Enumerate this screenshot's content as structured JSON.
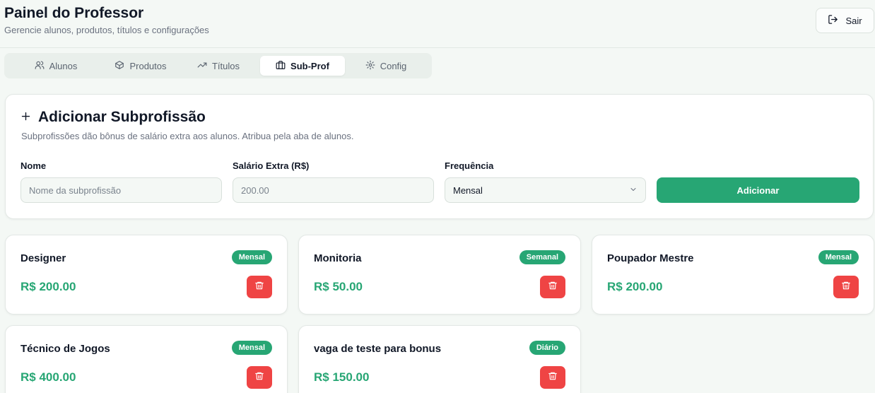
{
  "header": {
    "title": "Painel do Professor",
    "subtitle": "Gerencie alunos, produtos, títulos e configurações",
    "logout_label": "Sair"
  },
  "tabs": [
    {
      "label": "Alunos",
      "icon": "users-icon",
      "active": false
    },
    {
      "label": "Produtos",
      "icon": "package-icon",
      "active": false
    },
    {
      "label": "Títulos",
      "icon": "trending-up-icon",
      "active": false
    },
    {
      "label": "Sub-Prof",
      "icon": "briefcase-icon",
      "active": true
    },
    {
      "label": "Config",
      "icon": "gear-icon",
      "active": false
    }
  ],
  "form": {
    "title": "Adicionar Subprofissão",
    "description": "Subprofissões dão bônus de salário extra aos alunos. Atribua pela aba de alunos.",
    "name_label": "Nome",
    "name_placeholder": "Nome da subprofissão",
    "salary_label": "Salário Extra (R$)",
    "salary_placeholder": "200.00",
    "frequency_label": "Frequência",
    "frequency_value": "Mensal",
    "submit_label": "Adicionar"
  },
  "subprofessions": [
    {
      "name": "Designer",
      "frequency": "Mensal",
      "amount": "R$ 200.00"
    },
    {
      "name": "Monitoria",
      "frequency": "Semanal",
      "amount": "R$ 50.00"
    },
    {
      "name": "Poupador Mestre",
      "frequency": "Mensal",
      "amount": "R$ 200.00"
    },
    {
      "name": "Técnico de Jogos",
      "frequency": "Mensal",
      "amount": "R$ 400.00"
    },
    {
      "name": "vaga de teste para bonus",
      "frequency": "Diário",
      "amount": "R$ 150.00"
    }
  ],
  "colors": {
    "accent": "#27a674",
    "danger": "#ef4444",
    "background": "#f4f8f5"
  }
}
